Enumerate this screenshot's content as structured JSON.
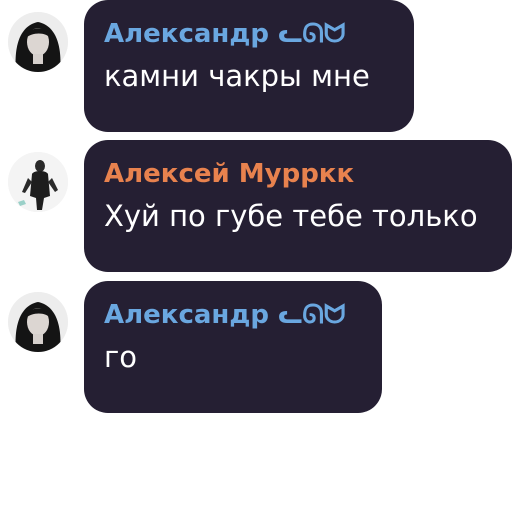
{
  "messages": [
    {
      "sender": "Александр ᓚᘏᗢ",
      "sender_color": "#6aa7e0",
      "text": "камни чакры мне",
      "avatar": "girl-dark-hair-avatar"
    },
    {
      "sender": "Алексей Мурркк",
      "sender_color": "#e8824e",
      "text": "Хуй по губе тебе только",
      "avatar": "dark-figure-avatar"
    },
    {
      "sender": "Александр ᓚᘏᗢ",
      "sender_color": "#6aa7e0",
      "text": "го",
      "avatar": "girl-dark-hair-avatar"
    }
  ],
  "bubble_color": "#251f33",
  "text_color": "#ffffff"
}
